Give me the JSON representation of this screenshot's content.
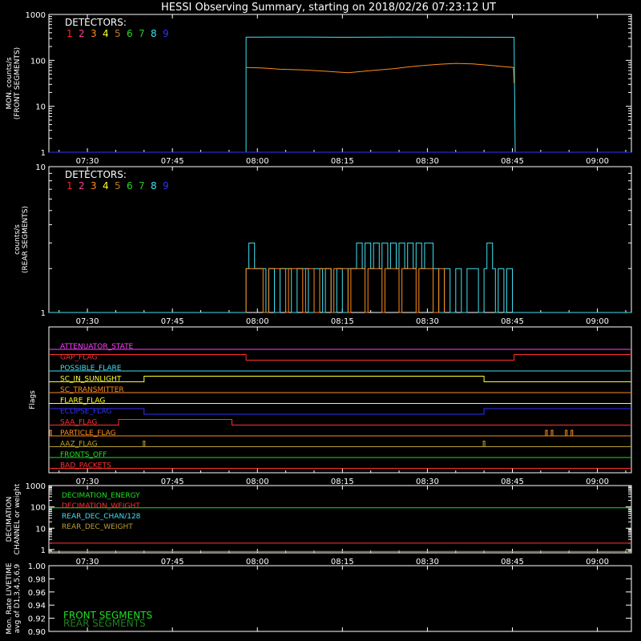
{
  "title": "HESSI Observing Summary, starting on 2018/02/26 07:23:12 UT",
  "time_ticks": [
    "07:30",
    "07:45",
    "08:00",
    "08:15",
    "08:30",
    "08:45",
    "09:00"
  ],
  "time_tick_minutes": [
    450,
    465,
    480,
    495,
    510,
    525,
    540
  ],
  "time_range_minutes": [
    443.2,
    546
  ],
  "detectors_label": "DETECTORS:",
  "detector_numbers": [
    "1",
    "2",
    "3",
    "4",
    "5",
    "6",
    "7",
    "8",
    "9"
  ],
  "detector_colors": [
    "#ff2020",
    "#ff3d8a",
    "#ff8a1a",
    "#ffff2a",
    "#b87a2a",
    "#20e020",
    "#30c030",
    "#40e0f0",
    "#3030ff"
  ],
  "chart_data": [
    {
      "type": "line",
      "id": "front",
      "ylabel_line1": "MON. counts/s",
      "ylabel_line2": "(FRONT SEGMENTS)",
      "scale": "log",
      "ylim": [
        1,
        1000
      ],
      "yticks": [
        "1",
        "10",
        "100",
        "1000"
      ],
      "series": [
        {
          "detector": "8",
          "color": "#40e0f0",
          "points": [
            [
              443.2,
              1
            ],
            [
              478.0,
              1
            ],
            [
              478.0,
              320
            ],
            [
              485,
              322
            ],
            [
              495,
              318
            ],
            [
              505,
              322
            ],
            [
              515,
              320
            ],
            [
              525.3,
              318
            ],
            [
              525.3,
              250
            ],
            [
              525.5,
              1
            ],
            [
              546,
              1
            ]
          ]
        },
        {
          "detector": "3",
          "color": "#ff8a1a",
          "points": [
            [
              478.0,
              70
            ],
            [
              481,
              68
            ],
            [
              484,
              64
            ],
            [
              488,
              62
            ],
            [
              492,
              58
            ],
            [
              496,
              54
            ],
            [
              500,
              60
            ],
            [
              504,
              66
            ],
            [
              508,
              75
            ],
            [
              512,
              82
            ],
            [
              515,
              86
            ],
            [
              518,
              84
            ],
            [
              521,
              78
            ],
            [
              524,
              72
            ],
            [
              525.2,
              70
            ],
            [
              525.3,
              32
            ]
          ]
        },
        {
          "detector": "9",
          "color": "#3030ff",
          "points": [
            [
              443.2,
              1
            ],
            [
              546,
              1
            ]
          ]
        }
      ]
    },
    {
      "type": "line",
      "id": "rear",
      "ylabel_line1": "counts/s",
      "ylabel_line2": "(REAR SEGMENTS)",
      "scale": "log",
      "ylim": [
        1,
        10
      ],
      "yticks": [
        "1",
        "10"
      ],
      "series": [
        {
          "detector": "8",
          "color": "#40e0f0",
          "points": [
            [
              443.2,
              1
            ],
            [
              478.0,
              1
            ],
            [
              478.0,
              2
            ],
            [
              478.5,
              2
            ],
            [
              478.5,
              3
            ],
            [
              479.5,
              3
            ],
            [
              479.5,
              2
            ],
            [
              481.5,
              2
            ],
            [
              481.5,
              1
            ],
            [
              482,
              1
            ],
            [
              482,
              2
            ],
            [
              483,
              2
            ],
            [
              483,
              1
            ],
            [
              484,
              1
            ],
            [
              484,
              2
            ],
            [
              486,
              2
            ],
            [
              486,
              1
            ],
            [
              487,
              1
            ],
            [
              487,
              2
            ],
            [
              489,
              2
            ],
            [
              489,
              1
            ],
            [
              490,
              1
            ],
            [
              490,
              2
            ],
            [
              491.5,
              2
            ],
            [
              491.5,
              1
            ],
            [
              492,
              1
            ],
            [
              492,
              2
            ],
            [
              493,
              2
            ],
            [
              493,
              1
            ],
            [
              494,
              1
            ],
            [
              494,
              2
            ],
            [
              495,
              2
            ],
            [
              495,
              1
            ],
            [
              496,
              1
            ],
            [
              496,
              2
            ],
            [
              497.5,
              2
            ],
            [
              497.5,
              3
            ],
            [
              498.5,
              3
            ],
            [
              498.5,
              2
            ],
            [
              499,
              2
            ],
            [
              499,
              3
            ],
            [
              500,
              3
            ],
            [
              500,
              2
            ],
            [
              500.5,
              2
            ],
            [
              500.5,
              3
            ],
            [
              501.5,
              3
            ],
            [
              501.5,
              2
            ],
            [
              502,
              2
            ],
            [
              502,
              3
            ],
            [
              503,
              3
            ],
            [
              503,
              2
            ],
            [
              503.5,
              2
            ],
            [
              503.5,
              3
            ],
            [
              504.5,
              3
            ],
            [
              504.5,
              2
            ],
            [
              505,
              2
            ],
            [
              505,
              3
            ],
            [
              506,
              3
            ],
            [
              506,
              2
            ],
            [
              506.5,
              2
            ],
            [
              506.5,
              3
            ],
            [
              507.5,
              3
            ],
            [
              507.5,
              2
            ],
            [
              508,
              2
            ],
            [
              508,
              3
            ],
            [
              509,
              3
            ],
            [
              509,
              2
            ],
            [
              509.5,
              2
            ],
            [
              509.5,
              3
            ],
            [
              511,
              3
            ],
            [
              511,
              2
            ],
            [
              512,
              2
            ],
            [
              512,
              1
            ],
            [
              513,
              1
            ],
            [
              513,
              2
            ],
            [
              514,
              2
            ],
            [
              514,
              1
            ],
            [
              515,
              1
            ],
            [
              515,
              2
            ],
            [
              516,
              2
            ],
            [
              516,
              1
            ],
            [
              517,
              1
            ],
            [
              517,
              2
            ],
            [
              519,
              2
            ],
            [
              519,
              1
            ],
            [
              520,
              1
            ],
            [
              520,
              2
            ],
            [
              520.5,
              2
            ],
            [
              520.5,
              3
            ],
            [
              521.5,
              3
            ],
            [
              521.5,
              2
            ],
            [
              522,
              2
            ],
            [
              522,
              1
            ],
            [
              522.5,
              1
            ],
            [
              522.5,
              2
            ],
            [
              523.5,
              2
            ],
            [
              523.5,
              1
            ],
            [
              524,
              1
            ],
            [
              524,
              2
            ],
            [
              525,
              2
            ],
            [
              525,
              1
            ],
            [
              546,
              1
            ]
          ]
        },
        {
          "detector": "3",
          "color": "#ff8a1a",
          "points": [
            [
              478.0,
              1
            ],
            [
              478.0,
              2
            ],
            [
              481,
              2
            ],
            [
              481,
              1
            ],
            [
              482,
              1
            ],
            [
              482,
              2
            ],
            [
              485,
              2
            ],
            [
              485,
              1
            ],
            [
              485.5,
              1
            ],
            [
              485.5,
              2
            ],
            [
              488,
              2
            ],
            [
              488,
              1
            ],
            [
              488.5,
              1
            ],
            [
              488.5,
              2
            ],
            [
              490,
              2
            ],
            [
              490,
              1
            ],
            [
              491,
              1
            ],
            [
              491,
              2
            ],
            [
              493,
              2
            ],
            [
              493,
              1
            ],
            [
              493.5,
              1
            ],
            [
              493.5,
              2
            ],
            [
              496,
              2
            ],
            [
              496,
              1
            ],
            [
              496.5,
              1
            ],
            [
              496.5,
              2
            ],
            [
              499,
              2
            ],
            [
              499,
              1
            ],
            [
              499.5,
              1
            ],
            [
              499.5,
              2
            ],
            [
              502,
              2
            ],
            [
              502,
              1
            ],
            [
              502.5,
              1
            ],
            [
              502.5,
              2
            ],
            [
              505,
              2
            ],
            [
              505,
              1
            ],
            [
              505.5,
              1
            ],
            [
              505.5,
              2
            ],
            [
              508,
              2
            ],
            [
              508,
              1
            ],
            [
              508.5,
              1
            ],
            [
              508.5,
              2
            ],
            [
              511,
              2
            ],
            [
              511,
              1
            ],
            [
              512,
              1
            ],
            [
              512,
              2
            ],
            [
              513,
              2
            ],
            [
              513,
              1
            ]
          ]
        }
      ]
    },
    {
      "type": "line",
      "id": "decimation",
      "ylabel_line1": "DECIMATION",
      "ylabel_line2": "CHANNEL or weight",
      "scale": "log",
      "ylim": [
        0.7,
        1000
      ],
      "yticks": [
        "1",
        "10",
        "100",
        "1000"
      ],
      "series": [
        {
          "name": "DECIMATION_ENERGY",
          "color": "#20e020",
          "points": [
            [
              443.2,
              90
            ],
            [
              546,
              90
            ]
          ]
        },
        {
          "name": "DECIMATION_WEIGHT",
          "color": "#ff3030",
          "points": [
            [
              443.2,
              2
            ],
            [
              546,
              2
            ]
          ]
        },
        {
          "name": "REAR_DEC_CHAN/128",
          "color": "#40e0f0",
          "points": []
        },
        {
          "name": "REAR_DEC_WEIGHT",
          "color": "#b8a030",
          "points": [
            [
              443.2,
              0.82
            ],
            [
              546,
              0.82
            ]
          ]
        }
      ]
    },
    {
      "type": "line",
      "id": "livetime",
      "ylabel_line1": "Mon. Rate LIVETIME",
      "ylabel_line2": "avg of D1,3,4,5,6,9",
      "ylim": [
        0.9,
        1.0
      ],
      "yticks": [
        "0.90",
        "0.92",
        "0.94",
        "0.96",
        "0.98",
        "1.00"
      ],
      "series": [
        {
          "name": "FRONT SEGMENTS",
          "color": "#20e020",
          "points": []
        },
        {
          "name": "REAR SEGMENTS",
          "color": "#208020",
          "points": []
        }
      ]
    }
  ],
  "flags": {
    "ylabel": "Flags",
    "rows": [
      {
        "name": "ATTENUATOR_STATE",
        "color": "#ff40ff",
        "segments": [
          [
            443.2,
            546,
            0
          ]
        ]
      },
      {
        "name": "GAP_FLAG",
        "color": "#ff3030",
        "segments": [
          [
            443.2,
            478.0,
            1
          ],
          [
            478.0,
            525.3,
            0
          ],
          [
            525.3,
            546,
            1
          ]
        ]
      },
      {
        "name": "POSSIBLE_FLARE",
        "color": "#40e0f0",
        "segments": [
          [
            443.2,
            546,
            0
          ]
        ]
      },
      {
        "name": "SC_IN_SUNLIGHT",
        "color": "#ffff2a",
        "segments": [
          [
            443.2,
            460.0,
            0
          ],
          [
            460.0,
            520.0,
            1
          ],
          [
            520.0,
            546,
            0
          ]
        ]
      },
      {
        "name": "SC_TRANSMITTER",
        "color": "#ff8a1a",
        "segments": [
          [
            443.2,
            546,
            0
          ]
        ]
      },
      {
        "name": "FLARE_FLAG",
        "color": "#ffff2a",
        "segments": [
          [
            443.2,
            546,
            0
          ]
        ]
      },
      {
        "name": "ECLIPSE_FLAG",
        "color": "#3030ff",
        "segments": [
          [
            443.2,
            460.0,
            1
          ],
          [
            460.0,
            520.0,
            0
          ],
          [
            520.0,
            546,
            1
          ]
        ]
      },
      {
        "name": "SAA_FLAG",
        "color": "#ff3030",
        "segments": [
          [
            443.2,
            455.5,
            0
          ],
          [
            455.5,
            475.5,
            1
          ],
          [
            475.5,
            546,
            0
          ]
        ]
      },
      {
        "name": "PARTICLE_FLAG",
        "color": "#ff8a1a",
        "segments": [
          [
            443.2,
            546,
            0
          ]
        ],
        "spikes": [
          443.5,
          531.0,
          532.0,
          534.5,
          535.5
        ]
      },
      {
        "name": "AAZ_FLAG",
        "color": "#b8a030",
        "segments": [
          [
            443.2,
            546,
            0
          ]
        ],
        "spikes": [
          460.0,
          520.0
        ]
      },
      {
        "name": "FRONTS_OFF",
        "color": "#20e020",
        "segments": [
          [
            443.2,
            546,
            0
          ]
        ]
      },
      {
        "name": "BAD_PACKETS",
        "color": "#ff3030",
        "segments": [
          [
            443.2,
            546,
            0
          ]
        ]
      }
    ]
  }
}
